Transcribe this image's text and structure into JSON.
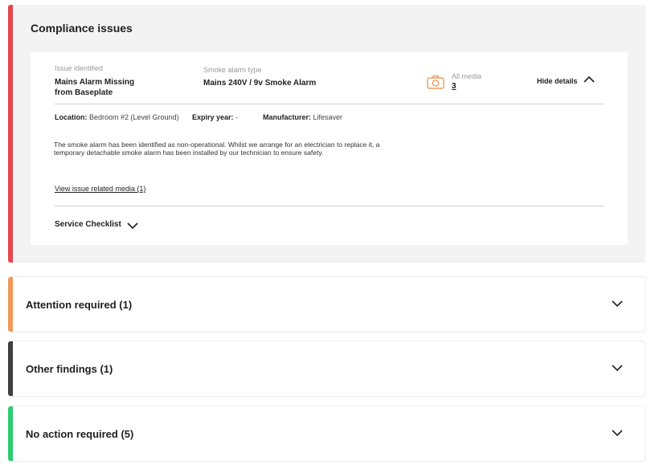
{
  "colors": {
    "compliance": "#e5484d",
    "attention": "#f0995a",
    "other": "#3f3f3f",
    "no_action": "#2ecc71",
    "camera": "#f0995a"
  },
  "compliance": {
    "title": "Compliance issues",
    "issue": {
      "issue_label": "Issue identified",
      "issue_value_line1": "Mains Alarm Missing",
      "issue_value_line2": "from Baseplate",
      "type_label": "Smoke alarm type",
      "type_value": "Mains 240V / 9v Smoke Alarm",
      "media_icon": "camera-icon",
      "media_label": "All media",
      "media_count": "3",
      "hide_details": "Hide details",
      "location_label": "Location:",
      "location_value": "Bedroom #2 (Level Ground)",
      "expiry_label": "Expiry year:",
      "expiry_value": "-",
      "manufacturer_label": "Manufacturer:",
      "manufacturer_value": "Lifesaver",
      "description_line1": "The smoke alarm has been identified as non-operational. Whilst we arrange for an electrician to replace it, a",
      "description_line2": "temporary detachable smoke alarm has been installed by our technician to ensure safety.",
      "media_link": "View issue related media (1)",
      "checklist_label": "Service Checklist"
    }
  },
  "sections": {
    "attention": "Attention required (1)",
    "other": "Other findings (1)",
    "no_action": "No action required (5)"
  }
}
